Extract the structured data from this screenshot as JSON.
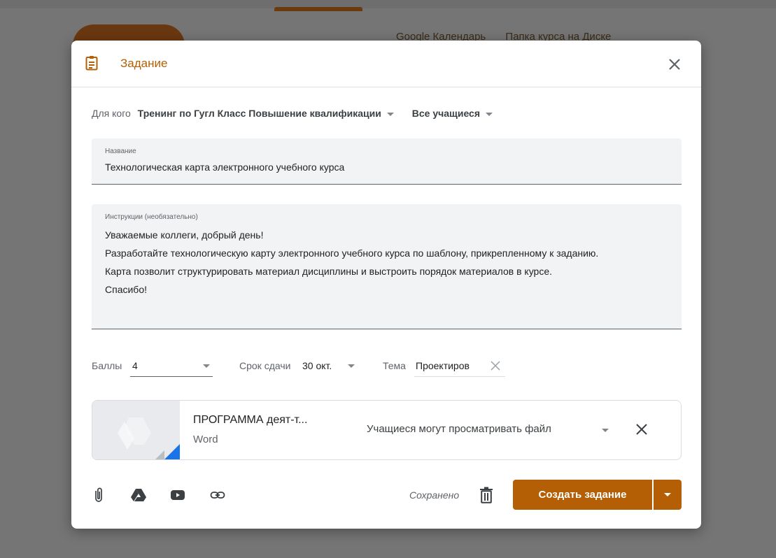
{
  "backdrop": {
    "links": [
      "Google Календарь",
      "Папка курса на Диске"
    ]
  },
  "dialog": {
    "title": "Задание",
    "icons": {
      "header": "assignment-icon",
      "close": "close-icon"
    },
    "for_label": "Для кого",
    "course": "Тренинг по Гугл Класс Повышение квалификации",
    "students": "Все учащиеся",
    "title_field": {
      "label": "Название",
      "value": "Технологическая карта электронного учебного курса"
    },
    "instructions": {
      "label": "Инструкции (необязательно)",
      "lines": [
        "Уважаемые коллеги, добрый день!",
        "Разработайте технологическую карту электронного учебного курса по шаблону, прикрепленному к заданию.",
        "Карта позволит структурировать материал дисциплины и выстроить порядок материалов в курсе.",
        "Спасибо!"
      ]
    },
    "points": {
      "label": "Баллы",
      "value": "4"
    },
    "due": {
      "label": "Срок сдачи",
      "value": "30 окт."
    },
    "topic": {
      "label": "Тема",
      "value": "Проектиров"
    },
    "attachment": {
      "name": "ПРОГРАММА деят-т...",
      "type": "Word",
      "permission": "Учащиеся могут просматривать файл"
    },
    "toolbar": {
      "icons": [
        "paperclip-icon",
        "google-drive-icon",
        "youtube-icon",
        "link-icon"
      ],
      "saved": "Сохранено",
      "create": "Создать задание"
    },
    "accent_color": "#b45f06"
  }
}
